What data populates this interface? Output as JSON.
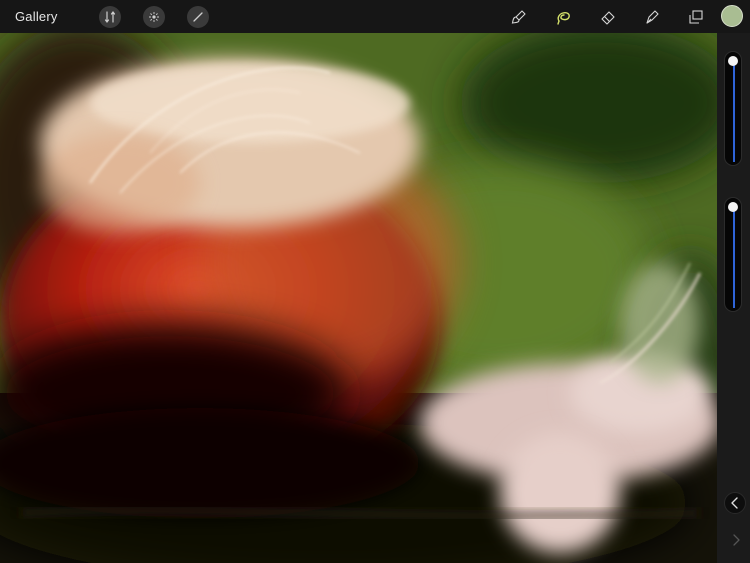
{
  "toolbar": {
    "gallery_label": "Gallery",
    "left_tools": [
      "wrench-icon",
      "magic-wand-icon",
      "cursor-arrow-icon"
    ],
    "right_tools": [
      "brush-icon",
      "smudge-icon",
      "eraser-icon",
      "pen-nib-icon",
      "layers-icon"
    ],
    "active_tool": "smudge-icon",
    "active_color": "#a9bd92",
    "accent_color": "#d3e06a"
  },
  "sidebar": {
    "brush_size_level": 1.0,
    "opacity_level": 1.0,
    "slider_color": "#2f64d8"
  }
}
